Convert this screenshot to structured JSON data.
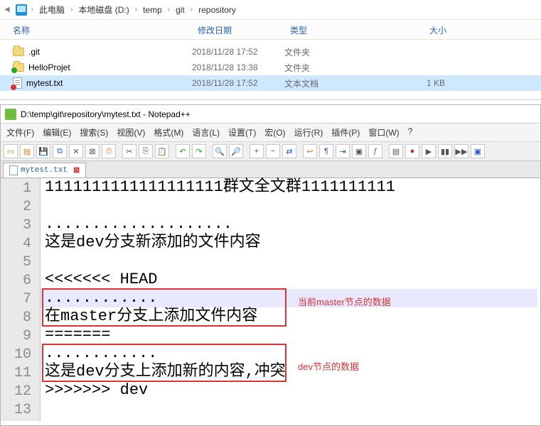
{
  "explorer": {
    "breadcrumb": [
      "此电脑",
      "本地磁盘 (D:)",
      "temp",
      "git",
      "repository"
    ],
    "columns": {
      "name": "名称",
      "modified": "修改日期",
      "type": "类型",
      "size": "大小"
    },
    "rows": [
      {
        "icon": "folder",
        "name": ".git",
        "modified": "2018/11/28 17:52",
        "type": "文件夹",
        "size": "",
        "selected": false
      },
      {
        "icon": "folder-green",
        "name": "HelloProjet",
        "modified": "2018/11/28 13:38",
        "type": "文件夹",
        "size": "",
        "selected": false
      },
      {
        "icon": "file-red",
        "name": "mytest.txt",
        "modified": "2018/11/28 17:52",
        "type": "文本文档",
        "size": "1 KB",
        "selected": true
      }
    ]
  },
  "npp": {
    "title": "D:\\temp\\git\\repository\\mytest.txt - Notepad++",
    "menus": [
      "文件(F)",
      "编辑(E)",
      "搜索(S)",
      "视图(V)",
      "格式(M)",
      "语言(L)",
      "设置(T)",
      "宏(O)",
      "运行(R)",
      "插件(P)",
      "窗口(W)",
      "?"
    ],
    "tab": {
      "label": "mytest.txt"
    },
    "lines": [
      "1111111111111111111群文全文群1111111111",
      "",
      "....................",
      "这是dev分支新添加的文件内容",
      "",
      "<<<<<<< HEAD",
      "............",
      "在master分支上添加文件内容",
      "=======",
      "............",
      "这是dev分支上添加新的内容,冲突",
      ">>>>>>> dev",
      ""
    ]
  },
  "annotations": {
    "a1": "当前master节点的数据",
    "a2": "dev节点的数据"
  }
}
